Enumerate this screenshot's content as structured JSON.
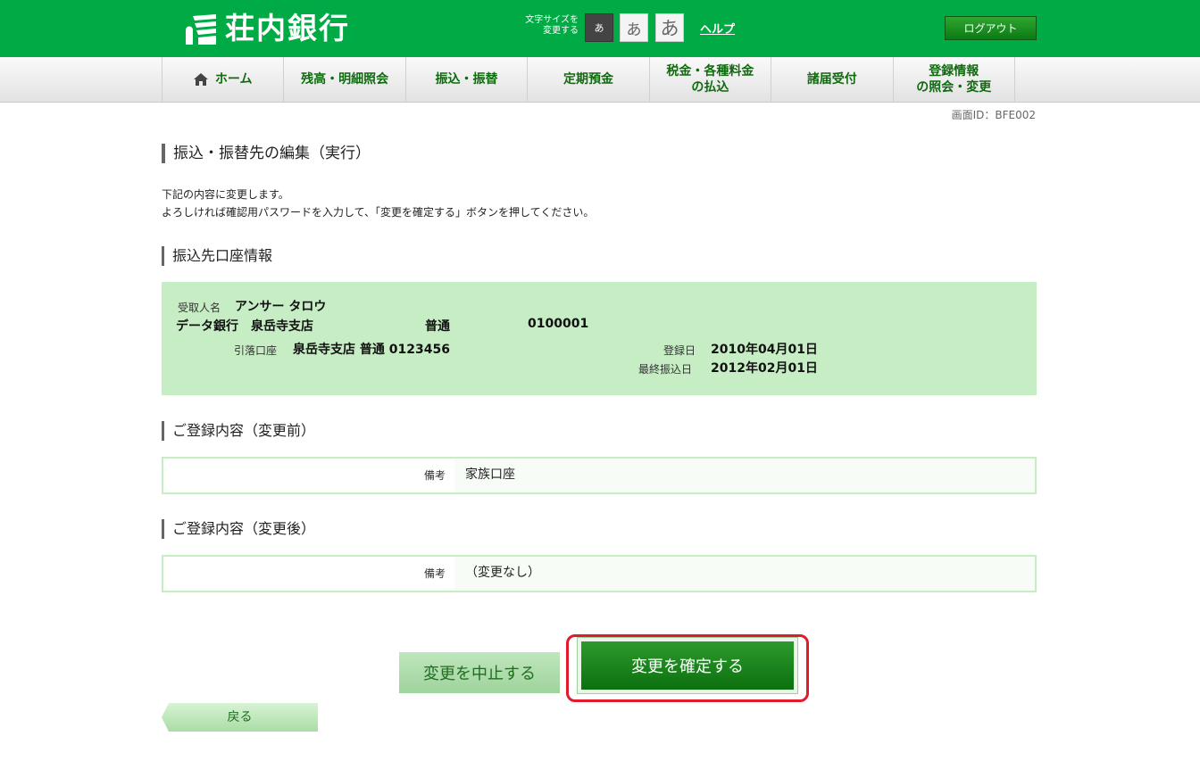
{
  "header": {
    "brand": "荘内銀行",
    "font_size_label_line1": "文字サイズを",
    "font_size_label_line2": "変更する",
    "font_small": "あ",
    "font_medium": "あ",
    "font_large": "あ",
    "help": "ヘルプ",
    "logout": "ログアウト"
  },
  "nav": {
    "home": "ホーム",
    "balance": "残高・明細照会",
    "transfer": "振込・振替",
    "deposit": "定期預金",
    "tax_line1": "税金・各種料金",
    "tax_line2": "の払込",
    "notifications": "諸届受付",
    "registration_line1": "登録情報",
    "registration_line2": "の照会・変更"
  },
  "screen_id": "画面ID：BFE002",
  "page_title": "振込・振替先の編集（実行）",
  "intro": {
    "line1": "下記の内容に変更します。",
    "line2": "よろしければ確認用パスワードを入力して、「変更を確定する」ボタンを押してください。"
  },
  "account_section": {
    "title": "振込先口座情報",
    "recipient_label": "受取人名",
    "recipient_name": "アンサー タロウ",
    "bank_branch": "データ銀行　泉岳寺支店",
    "account_type": "普通",
    "account_number": "0100001",
    "debit_label": "引落口座",
    "debit_value": "泉岳寺支店 普通 0123456",
    "registered_label": "登録日",
    "registered_date": "2010年04月01日",
    "last_transfer_label": "最終振込日",
    "last_transfer_date": "2012年02月01日"
  },
  "before": {
    "title": "ご登録内容（変更前）",
    "note_label": "備考",
    "note_value": "家族口座"
  },
  "after": {
    "title": "ご登録内容（変更後）",
    "note_label": "備考",
    "note_value": "（変更なし）"
  },
  "buttons": {
    "cancel": "変更を中止する",
    "confirm": "変更を確定する",
    "back": "戻る"
  },
  "colors": {
    "brand_green": "#00aa44",
    "panel_green": "#c6edc4",
    "highlight_red": "#e01b2b"
  }
}
